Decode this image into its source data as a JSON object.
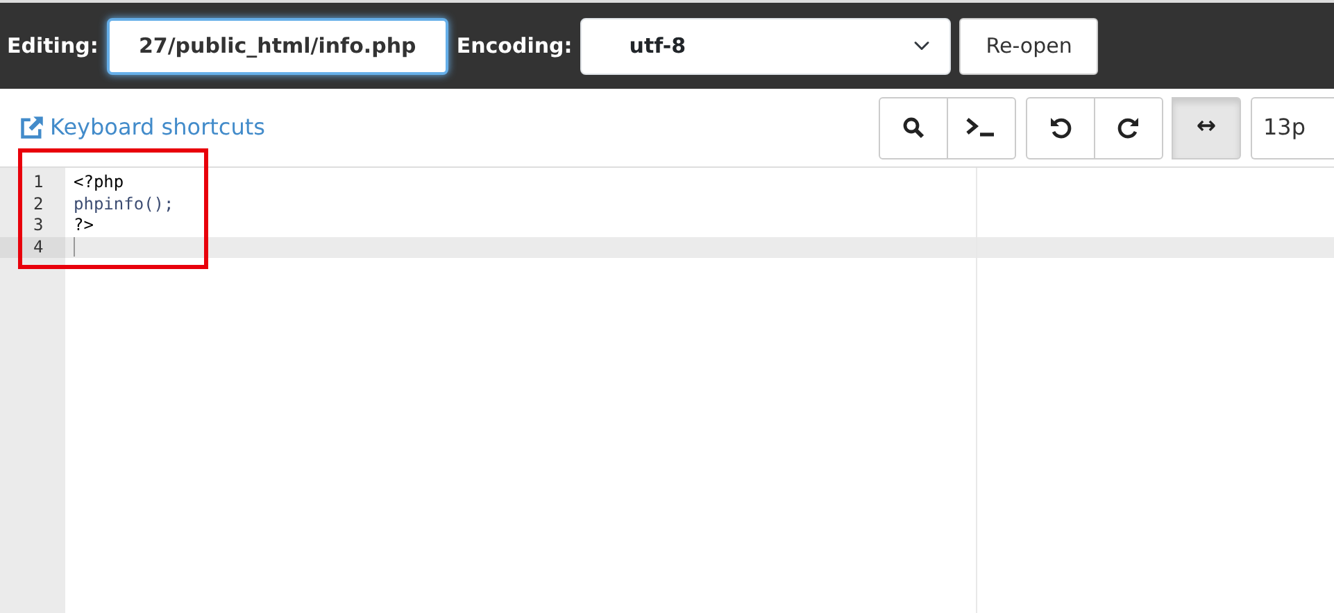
{
  "header": {
    "editing_label": "Editing:",
    "file_path": "27/public_html/info.php",
    "encoding_label": "Encoding:",
    "encoding": "utf-8",
    "reopen_button": "Re-open"
  },
  "toolbar": {
    "shortcuts_link": "Keyboard shortcuts",
    "wrap_toggle": {
      "label": "↔",
      "on": true
    },
    "font_size": "13p"
  },
  "editor": {
    "lines": [
      {
        "number": "1",
        "text": "<?php",
        "kind": "plain",
        "active": false
      },
      {
        "number": "2",
        "text": "phpinfo();",
        "kind": "function",
        "active": false
      },
      {
        "number": "3",
        "text": "?>",
        "kind": "plain",
        "active": false
      },
      {
        "number": "4",
        "active": true
      }
    ]
  }
}
